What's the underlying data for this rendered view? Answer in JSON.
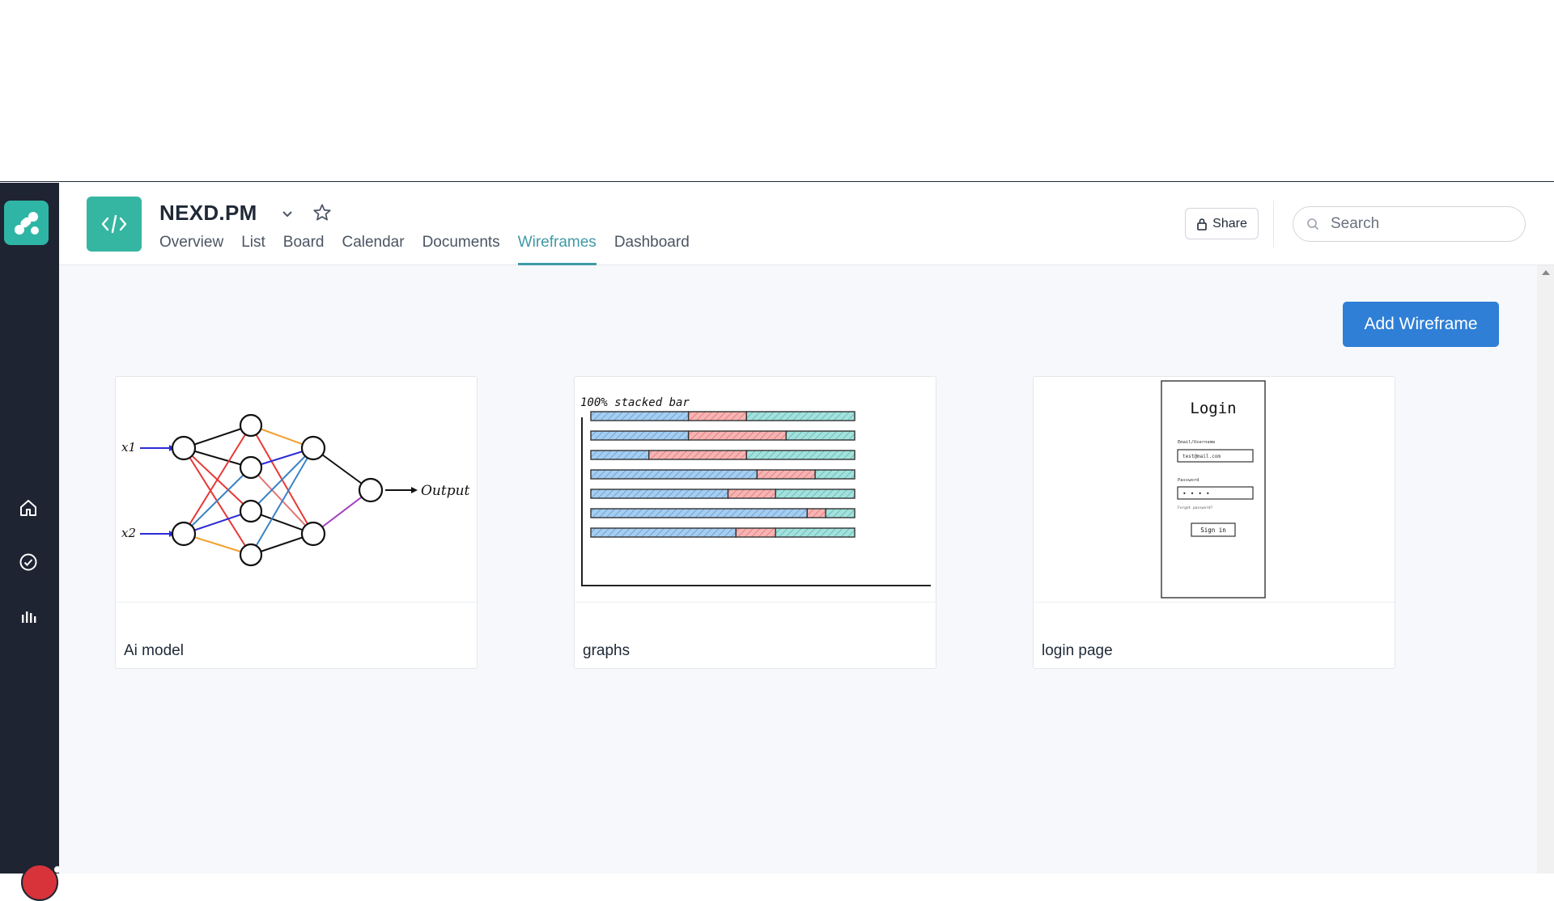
{
  "project": {
    "title": "NEXD.PM"
  },
  "tabs": [
    {
      "label": "Overview"
    },
    {
      "label": "List"
    },
    {
      "label": "Board"
    },
    {
      "label": "Calendar"
    },
    {
      "label": "Documents"
    },
    {
      "label": "Wireframes",
      "active": true
    },
    {
      "label": "Dashboard"
    }
  ],
  "header": {
    "share_label": "Share",
    "search_placeholder": "Search"
  },
  "main": {
    "add_button_label": "Add Wireframe"
  },
  "cards": [
    {
      "name": "Ai model",
      "thumb": {
        "labels": [
          "x1",
          "x2",
          "Output"
        ]
      }
    },
    {
      "name": "graphs",
      "thumb": {
        "title": "100% stacked bar"
      }
    },
    {
      "name": "login page",
      "thumb": {
        "title": "Login",
        "email_label": "Email/Username",
        "email_value": "test@mail.com",
        "password_label": "Password",
        "password_value": "• • • •",
        "forgot": "Forgot password?",
        "signin": "Sign in"
      }
    }
  ],
  "colors": {
    "sidebar": "#1e2432",
    "accent": "#3f9aa6",
    "primary_button": "#2f7fd6",
    "project_icon": "#35b6a2"
  }
}
